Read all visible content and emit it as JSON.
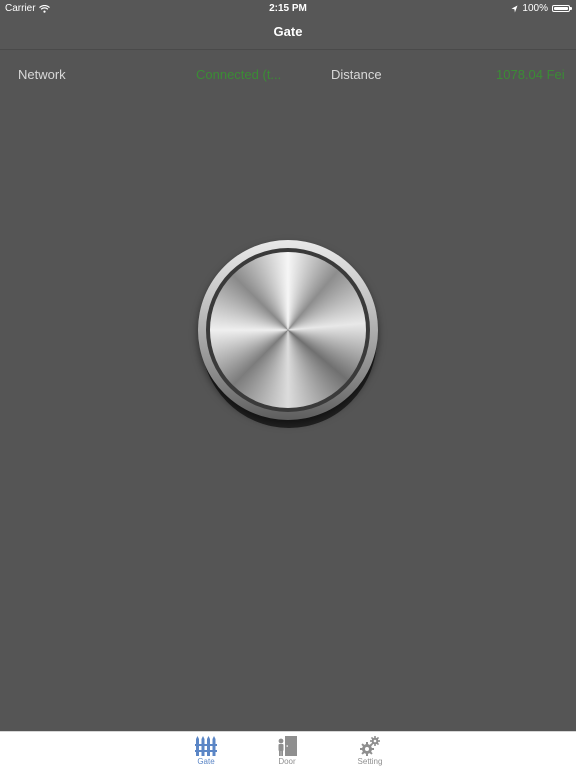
{
  "status_bar": {
    "carrier": "Carrier",
    "time": "2:15 PM",
    "battery_percent": "100%",
    "icons": [
      "wifi-icon",
      "location-arrow-icon",
      "battery-icon"
    ]
  },
  "navbar": {
    "title": "Gate"
  },
  "info": {
    "network_label": "Network",
    "network_value": "Connected (t...",
    "distance_label": "Distance",
    "distance_value": "1078.04 Fei",
    "value_color": "#3b8c35"
  },
  "tabbar": {
    "active_color": "#5b86c6",
    "inactive_color": "#8f8f8f",
    "tabs": [
      {
        "label": "Gate",
        "icon": "gate-icon",
        "active": true
      },
      {
        "label": "Door",
        "icon": "door-icon",
        "active": false
      },
      {
        "label": "Setting",
        "icon": "gears-icon",
        "active": false
      }
    ]
  }
}
